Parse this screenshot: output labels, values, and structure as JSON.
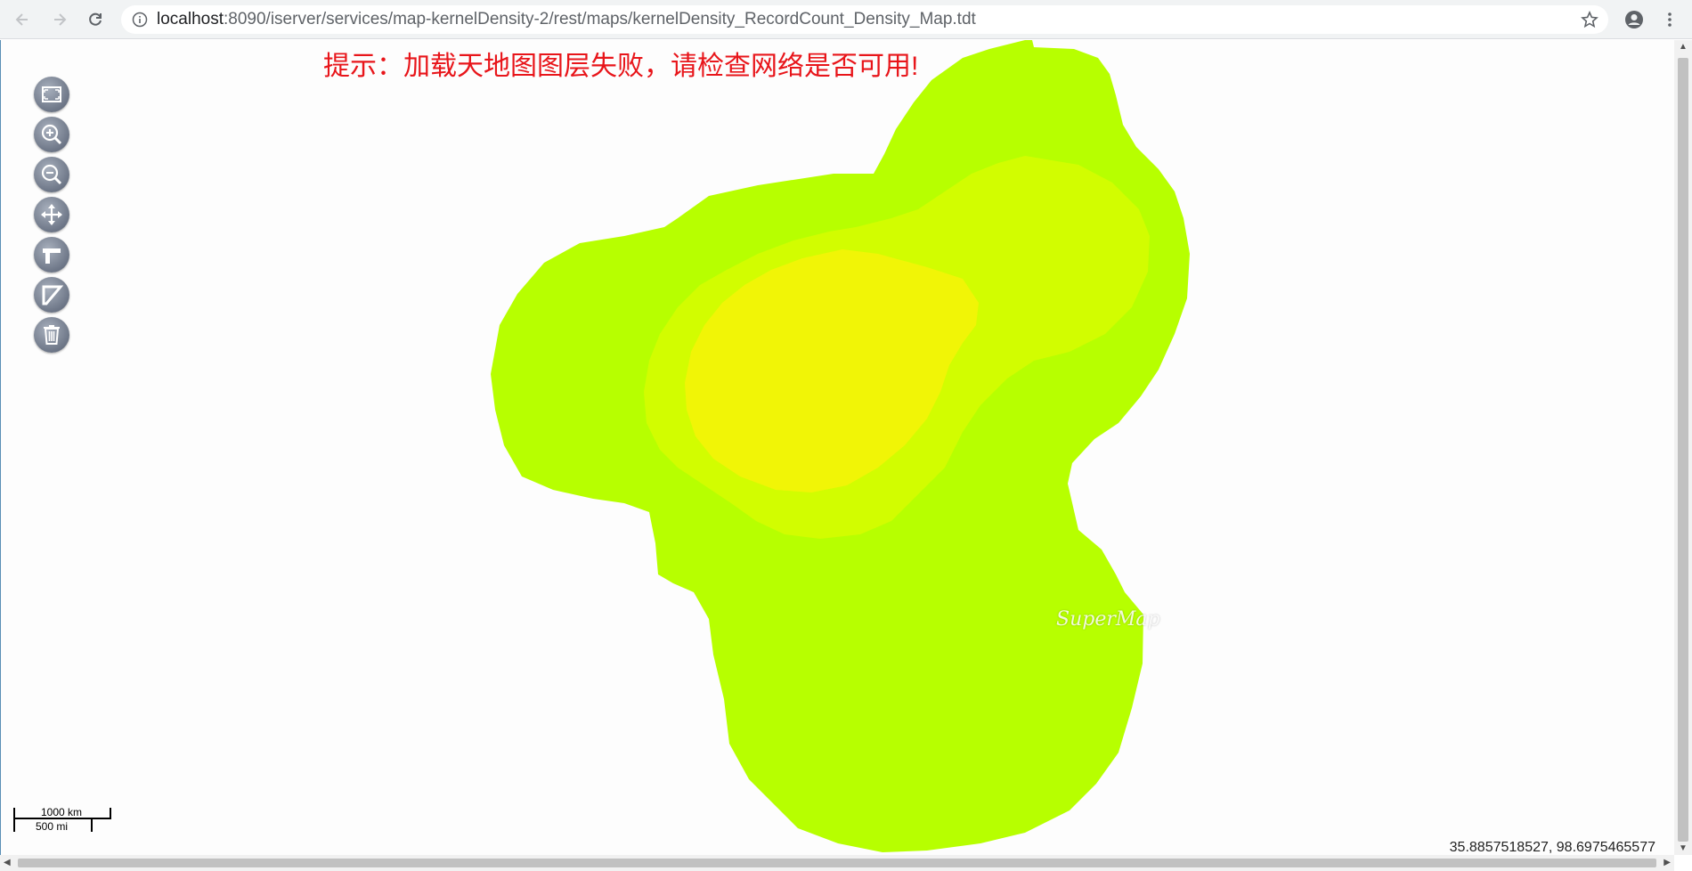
{
  "browser": {
    "url_host": "localhost",
    "url_rest": ":8090/iserver/services/map-kernelDensity-2/rest/maps/kernelDensity_RecordCount_Density_Map.tdt"
  },
  "map": {
    "notice": "提示：加载天地图图层失败，请检查网络是否可用!",
    "watermark": "SuperMap",
    "scale": {
      "metric": "1000 km",
      "imperial": "500 mi"
    },
    "coordinates": "35.8857518527, 98.6975465577",
    "density_colors": {
      "outer": "#b7ff00",
      "middle": "#d2fd00",
      "inner": "#f1f506"
    }
  },
  "toolbar": {
    "items": [
      {
        "name": "full-extent",
        "icon": "fullscreen-icon"
      },
      {
        "name": "zoom-in",
        "icon": "zoom-in-icon"
      },
      {
        "name": "zoom-out",
        "icon": "zoom-out-icon"
      },
      {
        "name": "pan",
        "icon": "pan-icon"
      },
      {
        "name": "measure-distance",
        "icon": "measure-distance-icon"
      },
      {
        "name": "measure-area",
        "icon": "measure-area-icon"
      },
      {
        "name": "clear",
        "icon": "trash-icon"
      }
    ]
  }
}
